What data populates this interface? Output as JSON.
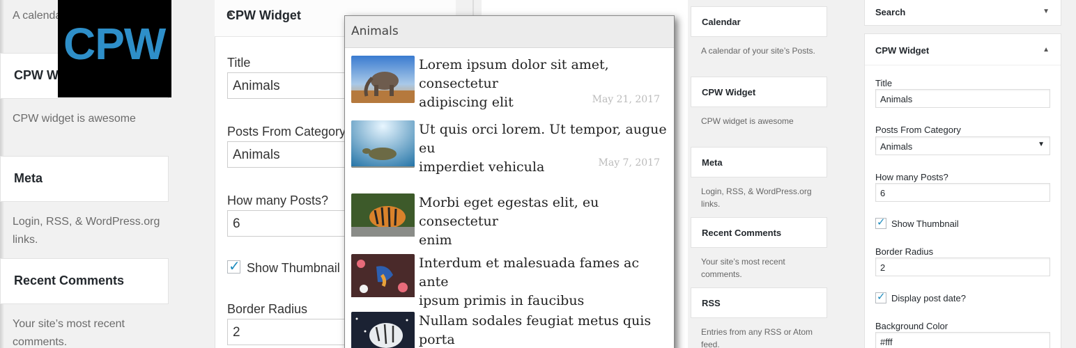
{
  "panel_a": {
    "calendar_desc": "A calendar",
    "logo_text": "CPW",
    "cpw_widget_title": "CPW Wid",
    "cpw_widget_desc": "CPW widget is awesome",
    "meta_title": "Meta",
    "meta_desc_line1": "Login, RSS, & WordPress.org",
    "meta_desc_line2": "links.",
    "recent_comments_title": "Recent Comments",
    "recent_comments_desc_line1": "Your site’s most recent",
    "recent_comments_desc_line2": "comments."
  },
  "panel_b": {
    "widget_title": "CPW Widget",
    "title_label": "Title",
    "title_value": "Animals",
    "category_label": "Posts From Category",
    "category_value": "Animals",
    "count_label": "How many Posts?",
    "count_value": "6",
    "thumbnail_label": "Show Thumbnail",
    "radius_label": "Border Radius",
    "radius_value": "2"
  },
  "preview": {
    "title": "Animals",
    "posts": [
      {
        "title_line1": "Lorem ipsum dolor sit amet, consectetur",
        "title_line2": "adipiscing elit",
        "date": "May 21, 2017"
      },
      {
        "title_line1": "Ut quis orci lorem. Ut tempor, augue eu",
        "title_line2": "imperdiet vehicula",
        "date": "May 7, 2017"
      },
      {
        "title_line1": "Morbi eget egestas elit, eu consectetur",
        "title_line2": "enim",
        "date": ""
      },
      {
        "title_line1": "Interdum et malesuada fames ac ante",
        "title_line2": "ipsum primis in faucibus",
        "date": ""
      },
      {
        "title_line1": "Nullam sodales feugiat metus quis porta",
        "title_line2": "",
        "date": ""
      }
    ]
  },
  "panel_c": {
    "calendar_title": "Calendar",
    "calendar_desc": "A calendar of your site’s Posts.",
    "cpw_title": "CPW Widget",
    "cpw_desc": "CPW widget is awesome",
    "meta_title": "Meta",
    "meta_desc_line1": "Login, RSS, & WordPress.org",
    "meta_desc_line2": "links.",
    "recent_title": "Recent Comments",
    "recent_desc_line1": "Your site’s most recent",
    "recent_desc_line2": "comments.",
    "rss_title": "RSS",
    "rss_desc_line1": "Entries from any RSS or Atom",
    "rss_desc_line2": "feed."
  },
  "panel_d": {
    "search_title": "Search",
    "widget_title": "CPW Widget",
    "title_label": "Title",
    "title_value": "Animals",
    "category_label": "Posts From Category",
    "category_value": "Animals",
    "count_label": "How many Posts?",
    "count_value": "6",
    "thumbnail_label": "Show Thumbnail",
    "radius_label": "Border Radius",
    "radius_value": "2",
    "date_label": "Display post date?",
    "bg_label": "Background Color",
    "bg_value": "#fff"
  },
  "icons": {
    "collapse": "caret-up-icon",
    "expand": "caret-down-icon",
    "check": "checkmark-icon",
    "dropdown": "dropdown-arrow-icon"
  },
  "colors": {
    "logo_bg": "#000000",
    "logo_text": "#2e8fc9",
    "checkmark": "#1e8cbe"
  }
}
